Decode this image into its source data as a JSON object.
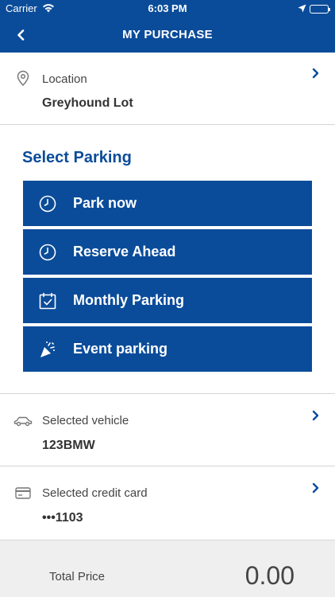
{
  "status_bar": {
    "carrier": "Carrier",
    "time": "6:03 PM"
  },
  "header": {
    "title": "MY PURCHASE",
    "back_icon": "chevron-left-icon"
  },
  "location": {
    "label": "Location",
    "value": "Greyhound Lot",
    "icon": "map-pin-icon"
  },
  "select_parking": {
    "title": "Select Parking",
    "options": [
      {
        "label": "Park now",
        "icon": "clock-icon"
      },
      {
        "label": "Reserve Ahead",
        "icon": "clock-icon"
      },
      {
        "label": "Monthly Parking",
        "icon": "calendar-check-icon"
      },
      {
        "label": "Event parking",
        "icon": "party-popper-icon"
      }
    ]
  },
  "vehicle": {
    "label": "Selected vehicle",
    "value": "123BMW",
    "icon": "car-icon"
  },
  "credit_card": {
    "label": "Selected credit card",
    "value": "•••1103",
    "icon": "credit-card-icon"
  },
  "footer": {
    "total_label": "Total Price",
    "total_value": "0.00"
  },
  "colors": {
    "brand": "#0a4c9a",
    "footer_bg": "#efefef"
  }
}
